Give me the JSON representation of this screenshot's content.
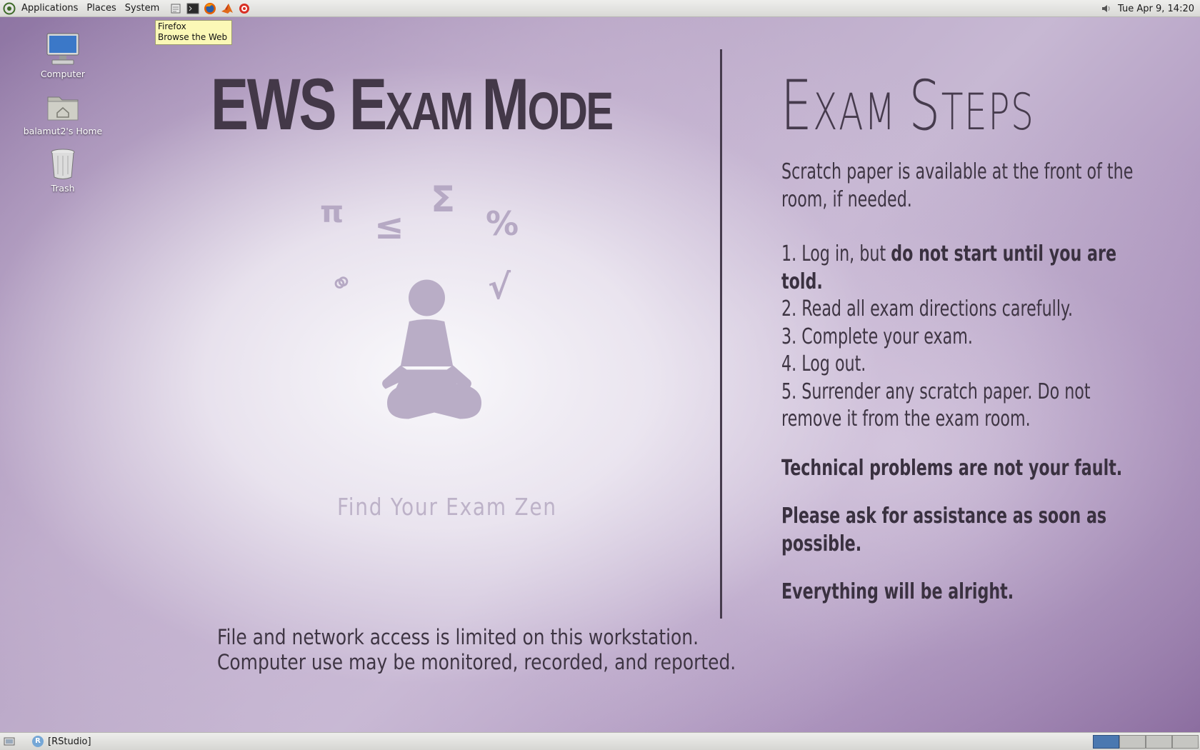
{
  "top_panel": {
    "menus": [
      "Applications",
      "Places",
      "System"
    ],
    "launchers": [
      "file-manager-icon",
      "terminal-icon",
      "firefox-icon",
      "matlab-icon",
      "settings-icon"
    ],
    "clock": "Tue Apr  9, 14:20"
  },
  "tooltip": {
    "title": "Firefox",
    "subtitle": "Browse the Web"
  },
  "desktop_icons": [
    {
      "label": "Computer",
      "icon": "computer-icon"
    },
    {
      "label": "balamut2's Home",
      "icon": "home-folder-icon"
    },
    {
      "label": "Trash",
      "icon": "trash-icon"
    }
  ],
  "wallpaper": {
    "title_parts": [
      "EWS ",
      "E",
      "XAM ",
      "M",
      "ODE"
    ],
    "symbols": [
      "π",
      "≤",
      "Σ",
      "%",
      "⚭",
      "√"
    ],
    "caption": "Find Your Exam Zen",
    "notice_lines": [
      "File and network access is limited on this workstation.",
      "Computer use may be monitored, recorded, and reported."
    ],
    "steps_heading_parts": [
      "E",
      "XAM ",
      "S",
      "TEPS"
    ],
    "intro": "Scratch paper is available at the front of the room, if needed.",
    "step1_plain": "1.  Log in, but ",
    "step1_bold": "do not start until you are told.",
    "steps": [
      "2.  Read all exam directions carefully.",
      "3.  Complete your exam.",
      "4.  Log out.",
      "5.  Surrender any scratch paper.  Do not remove it from the exam room."
    ],
    "reassurances": [
      "Technical problems are not your fault.",
      "Please ask for assistance as soon as possible.",
      "Everything will be alright."
    ],
    "colors": {
      "text_dark": "#433848",
      "figure": "#b9adc6"
    }
  },
  "bottom_panel": {
    "task_label": "[RStudio]",
    "task_icon": "R",
    "workspace_count": 4,
    "active_workspace": 1
  }
}
